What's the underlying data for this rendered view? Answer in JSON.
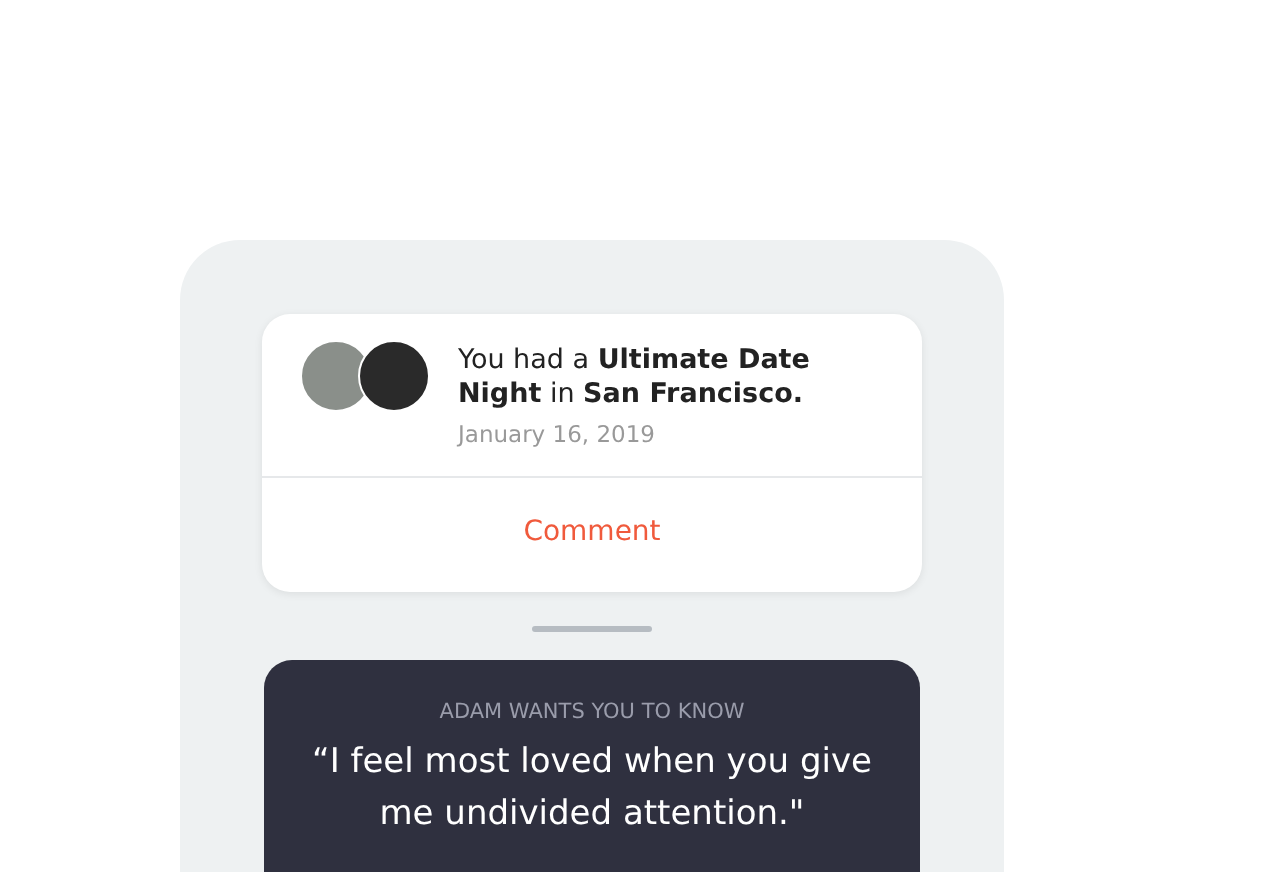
{
  "activity_card": {
    "message": "You had a **Ultimate Date Night** in **San Francisco.**",
    "date": "January 16, 2019",
    "action": "Comment"
  },
  "note_card": {
    "eyebrow": "ADAM WANTS YOU TO KNOW",
    "quote": "“I feel most loved when you give me undivided attention.\""
  }
}
